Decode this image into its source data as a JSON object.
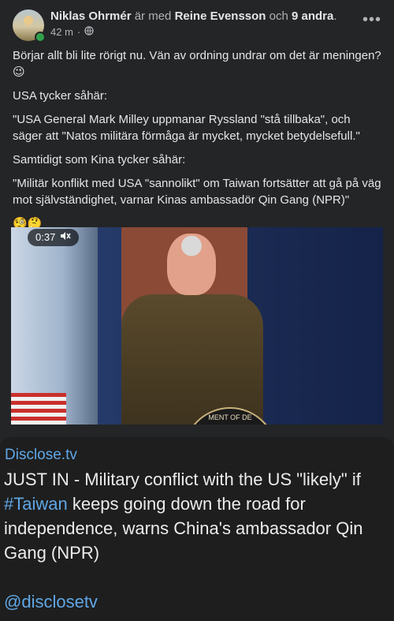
{
  "post": {
    "author": "Niklas Ohrmér",
    "with_text": "är med",
    "tagged": "Reine Evensson",
    "and_text": "och",
    "others": "9 andra",
    "period": ".",
    "time": "42 m",
    "dot": "·",
    "more_icon": "more-horizontal-icon",
    "privacy_icon": "globe-icon",
    "paragraphs": [
      "Börjar allt bli lite rörigt nu. Vän av ordning undrar om det är meningen?",
      "USA tycker såhär:",
      "\"USA General Mark Milley uppmanar Ryssland \"stå tillbaka\", och säger att \"Natos militära förmåga är mycket, mycket betydelsefull.\"",
      "Samtidigt som Kina tycker såhär:",
      "\"Militär konflikt med USA \"sannolikt\" om Taiwan fortsätter att gå på väg mot självständighet, varnar Kinas ambassadör Qin Gang (NPR)\""
    ],
    "emoji_1": "😉",
    "emoji_row": "🧐🤔"
  },
  "video": {
    "timer": "0:37",
    "mute_icon": "mute-icon",
    "seal_text": "MENT OF DE"
  },
  "card": {
    "source": "Disclose.tv",
    "text_before": "JUST IN - Military conflict with the US \"likely\" if ",
    "hashtag": "#Taiwan",
    "text_after": " keeps going down the road for independence, warns China's ambassador Qin Gang (NPR)",
    "handle": "@disclosetv"
  }
}
